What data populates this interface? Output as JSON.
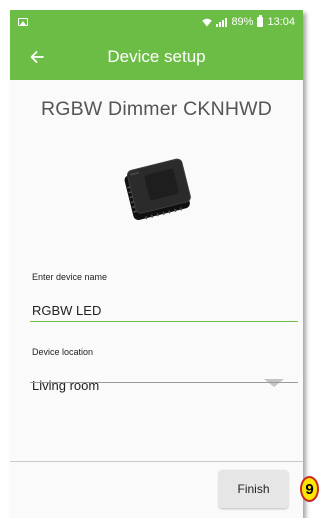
{
  "status_bar": {
    "battery_text": "89%",
    "time": "13:04"
  },
  "app_bar": {
    "title": "Device setup"
  },
  "device": {
    "model_name": "RGBW Dimmer CKNHWD"
  },
  "form": {
    "name_label": "Enter device name",
    "name_value": "RGBW LED",
    "location_label": "Device location",
    "location_value": "Living room"
  },
  "footer": {
    "finish_label": "Finish"
  },
  "annotation": {
    "badge_number": "9"
  },
  "colors": {
    "accent": "#6cbd45",
    "input_underline_active": "#6cbd45",
    "badge_fill": "#ffe600",
    "badge_border": "#c62828"
  }
}
